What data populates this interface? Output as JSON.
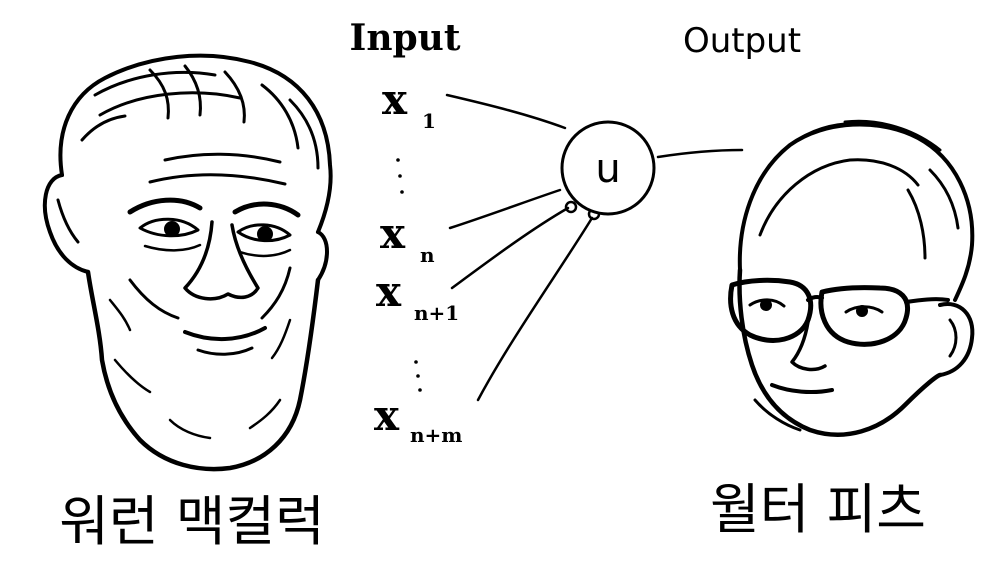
{
  "diagram": {
    "input_heading": "Input",
    "output_heading": "Output",
    "neuron_label": "u",
    "inputs": [
      {
        "var": "x",
        "sub": "1"
      },
      {
        "var": "x",
        "sub": "n"
      },
      {
        "var": "x",
        "sub": "n+1"
      },
      {
        "var": "x",
        "sub": "n+m"
      }
    ],
    "left_person": {
      "name": "워런 맥컬럭",
      "portrait": "bearded-man-portrait"
    },
    "right_person": {
      "name": "월터 피츠",
      "portrait": "glasses-man-portrait"
    }
  },
  "colors": {
    "ink": "#000000",
    "paper": "#ffffff"
  }
}
